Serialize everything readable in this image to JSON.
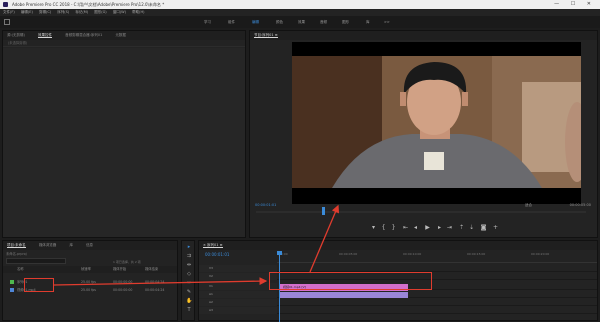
{
  "titlebar": {
    "title": "Adobe Premiere Pro CC 2018 - C:\\用户\\文档\\Adobe\\Premiere Pro\\12.0\\未命名 *"
  },
  "menubar": {
    "items": [
      "文件(F)",
      "编辑(E)",
      "剪辑(C)",
      "序列(S)",
      "标记(M)",
      "图形(G)",
      "窗口(W)",
      "帮助(H)"
    ]
  },
  "workspaces": {
    "items": [
      "学习",
      "组件",
      "编辑",
      "颜色",
      "效果",
      "音频",
      "图形",
      "库",
      ">>"
    ],
    "active_index": 2
  },
  "source_panel": {
    "tabs": [
      "源:(无剪辑)",
      "效果控件",
      "音频剪辑混合器:序列01",
      "元数据"
    ],
    "selected_tab": 1,
    "sub_label": "(未选择剪辑)"
  },
  "program_panel": {
    "title": "节目:序列01 ≡",
    "timecode": "00:00:01:01",
    "duration": "00:00:05:00",
    "fit": "适合",
    "quality": "完整"
  },
  "project_panel": {
    "tabs": [
      "项目:未命名",
      "媒体浏览器",
      "库",
      "信息"
    ],
    "path": "未命名.prproj",
    "item_count": "1 项已选择，共 2 项",
    "search_placeholder": "",
    "columns": [
      "名称",
      "帧速率",
      "媒体开始",
      "媒体结束"
    ],
    "rows": [
      {
        "name": "序列01",
        "fps": "25.00 fps",
        "start": "00:00:00:00",
        "end": "00:00:04:24",
        "color": "#4fb84f"
      },
      {
        "name": "视频01.mp4",
        "fps": "25.00 fps",
        "start": "00:00:00:00",
        "end": "00:00:04:24",
        "color": "#4f86d8"
      }
    ]
  },
  "timeline_panel": {
    "title": "× 序列01 ≡",
    "timecode": "00:00:01:01",
    "ruler": [
      "00:00",
      "00:00:05:00",
      "00:00:10:00",
      "00:00:15:00",
      "00:00:20:00"
    ],
    "tracks": [
      "V3",
      "V2",
      "V1",
      "A1",
      "A2",
      "A3"
    ],
    "clip_video": "视频01.mp4 [V]",
    "clip_audio": ""
  },
  "accent": "#3b8bd8",
  "annotation_color": "#e03c2e"
}
